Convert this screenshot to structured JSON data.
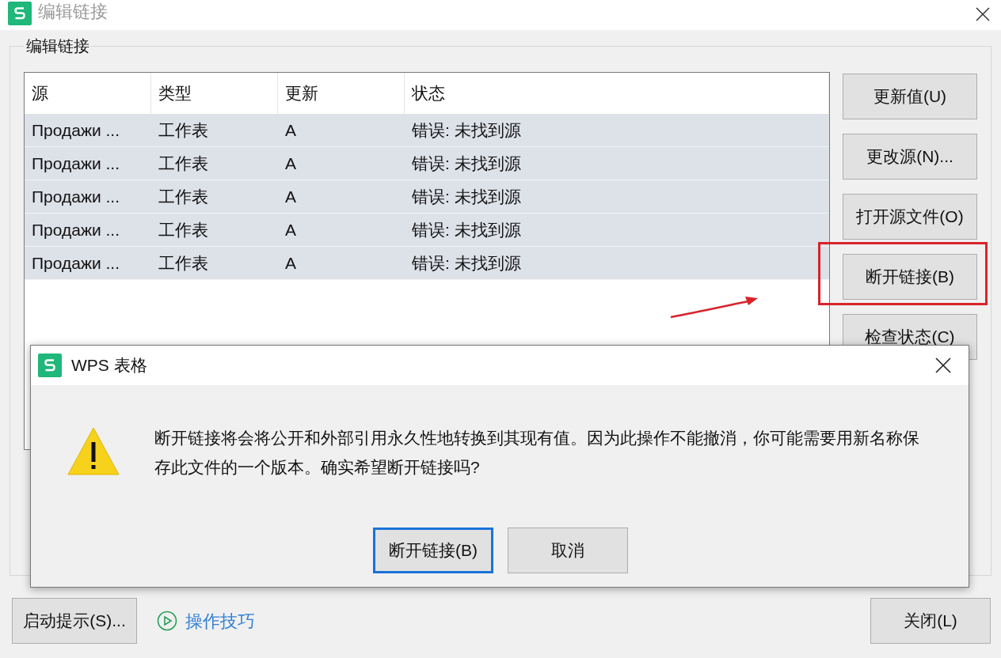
{
  "window": {
    "title": "编辑链接"
  },
  "group": {
    "legend": "编辑链接"
  },
  "table": {
    "columns": [
      "源",
      "类型",
      "更新",
      "状态"
    ],
    "rows": [
      {
        "cells": [
          "Продажи ...",
          "工作表",
          "A",
          "错误: 未找到源"
        ],
        "selected": true
      },
      {
        "cells": [
          "Продажи ...",
          "工作表",
          "A",
          "错误: 未找到源"
        ],
        "selected": true
      },
      {
        "cells": [
          "Продажи ...",
          "工作表",
          "A",
          "错误: 未找到源"
        ],
        "selected": true
      },
      {
        "cells": [
          "Продажи ...",
          "工作表",
          "A",
          "错误: 未找到源"
        ],
        "selected": true
      },
      {
        "cells": [
          "Продажи ...",
          "工作表",
          "A",
          "错误: 未找到源"
        ],
        "selected": true
      }
    ]
  },
  "side_buttons": [
    {
      "label": "更新值(U)",
      "annotated": false
    },
    {
      "label": "更改源(N)...",
      "annotated": false
    },
    {
      "label": "打开源文件(O)",
      "annotated": false
    },
    {
      "label": "断开链接(B)",
      "annotated": true
    },
    {
      "label": "检查状态(C)",
      "annotated": false
    }
  ],
  "footer": {
    "tips_button": "启动提示(S)...",
    "tips_link": "操作技巧",
    "close_button": "关闭(L)"
  },
  "alert": {
    "title": "WPS 表格",
    "message": "断开链接将会将公开和外部引用永久性地转换到其现有值。因为此操作不能撤消，你可能需要用新名称保存此文件的一个版本。确实希望断开链接吗?",
    "buttons": [
      {
        "label": "断开链接(B)",
        "default": true
      },
      {
        "label": "取消",
        "default": false
      }
    ]
  }
}
